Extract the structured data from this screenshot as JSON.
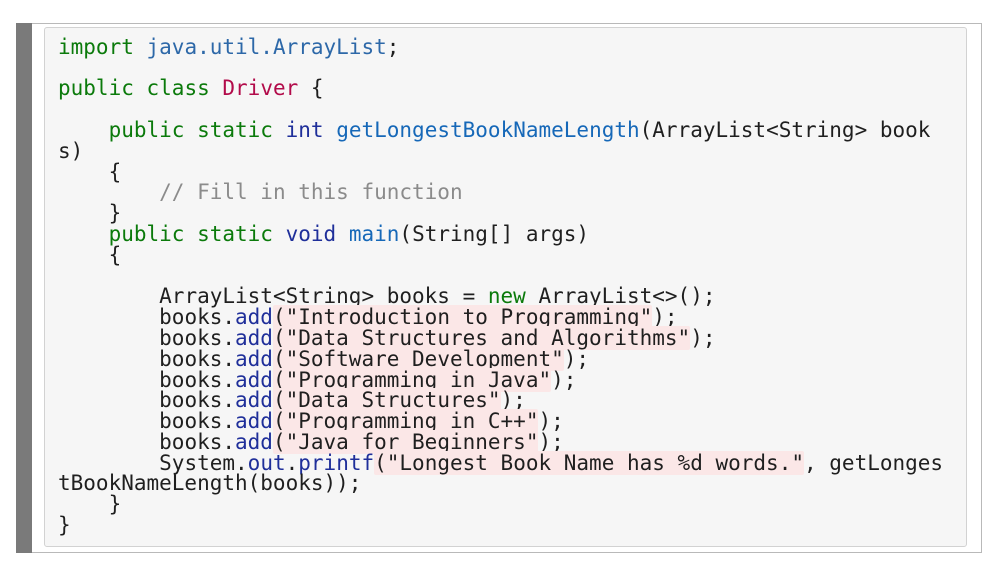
{
  "code": {
    "line1": {
      "kw": "import",
      "rest": "java.util.ArrayList",
      "end": ";"
    },
    "line2": {
      "kw1": "public",
      "kw2": "class",
      "cls": "Driver",
      "brace": "{"
    },
    "line3": {
      "indent": "    ",
      "kw1": "public",
      "kw2": "static",
      "type": "int",
      "fn": "getLongestBookNameLength",
      "params": "(ArrayList<String> book"
    },
    "line3b": "s)",
    "line4": "    {",
    "line5": {
      "indent": "        ",
      "comment": "// Fill in this function"
    },
    "line6": "    }",
    "line7": {
      "indent": "    ",
      "kw1": "public",
      "kw2": "static",
      "type": "void",
      "fn": "main",
      "params": "(String[] args)"
    },
    "line8": "    {",
    "line9": {
      "indent": "        ",
      "pre": "ArrayList<String> books = ",
      "kw": "new",
      "post": " ArrayList<>();"
    },
    "adds": [
      {
        "obj": "books.",
        "m": "add",
        "arg": "(\"Introduction to Programming\"",
        "end": ");"
      },
      {
        "obj": "books.",
        "m": "add",
        "arg": "(\"Data Structures and Algorithms\"",
        "end": ");"
      },
      {
        "obj": "books.",
        "m": "add",
        "arg": "(\"Software Development\"",
        "end": ");"
      },
      {
        "obj": "books.",
        "m": "add",
        "arg": "(\"Programming in Java\"",
        "end": ");"
      },
      {
        "obj": "books.",
        "m": "add",
        "arg": "(\"Data Structures\"",
        "end": ");"
      },
      {
        "obj": "books.",
        "m": "add",
        "arg": "(\"Programming in C++\"",
        "end": ");"
      },
      {
        "obj": "books.",
        "m": "add",
        "arg": "(\"Java for Beginners\"",
        "end": ");"
      }
    ],
    "printf": {
      "sys": "System.",
      "out": "out",
      "dot": ".",
      "fn": "printf",
      "arg": "(\"Longest Book Name has %d words.\"",
      "rest": ", getLonges"
    },
    "printf_b": "tBookNameLength(books));",
    "line_close1": "    }",
    "line_close2": "}"
  }
}
